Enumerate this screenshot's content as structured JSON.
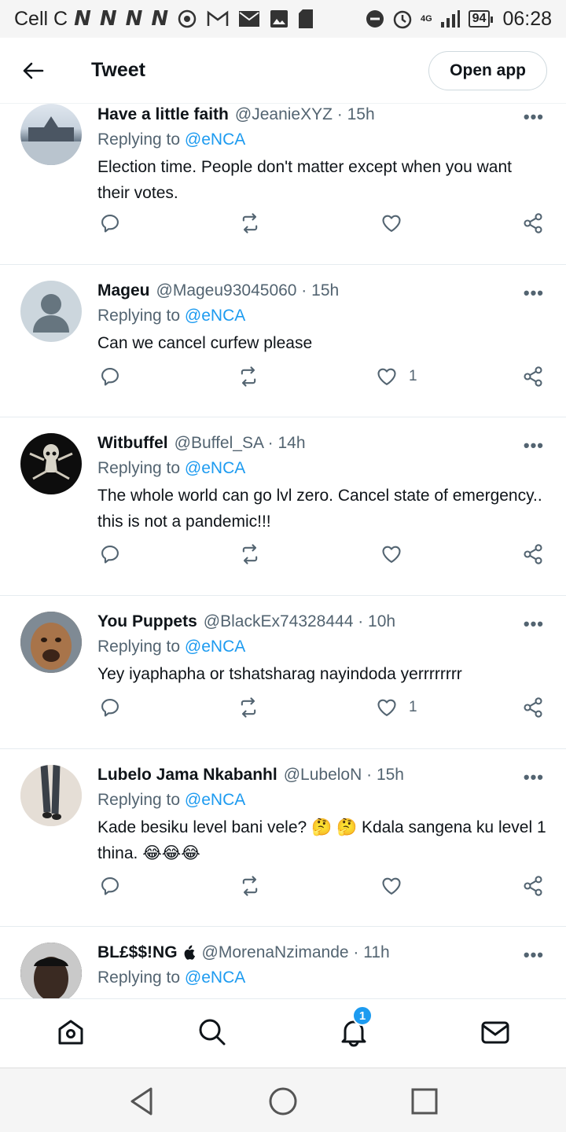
{
  "status_bar": {
    "carrier": "Cell C",
    "network_badges": [
      "N",
      "N",
      "N",
      "N"
    ],
    "network_type": "4G",
    "battery": "94",
    "time": "06:28"
  },
  "header": {
    "back_icon": "arrow-left-icon",
    "title": "Tweet",
    "open_app_label": "Open app"
  },
  "tweets": [
    {
      "name": "Have a little faith",
      "handle": "@JeanieXYZ · 15h",
      "replying_prefix": "Replying to",
      "replying_to": "@eNCA",
      "text": "Election time. People don't matter except when you want their votes.",
      "likes": ""
    },
    {
      "name": "Mageu",
      "handle": "@Mageu93045060 · 15h",
      "replying_prefix": "Replying to",
      "replying_to": "@eNCA",
      "text": "Can we cancel curfew please",
      "likes": "1"
    },
    {
      "name": "Witbuffel",
      "handle": "@Buffel_SA · 14h",
      "replying_prefix": "Replying to",
      "replying_to": "@eNCA",
      "text": "The whole world can go lvl zero. Cancel state of emergency.. this is not a pandemic!!!",
      "likes": ""
    },
    {
      "name": "You Puppets",
      "handle": "@BlackEx74328444 · 10h",
      "replying_prefix": "Replying to",
      "replying_to": "@eNCA",
      "text": "Yey iyaphapha or tshatsharag nayindoda yerrrrrrrr",
      "likes": "1"
    },
    {
      "name": "Lubelo Jama Nkabanhl",
      "handle": "@LubeloN · 15h",
      "replying_prefix": "Replying to",
      "replying_to": "@eNCA",
      "text": "Kade besiku level bani vele? 🤔 🤔 Kdala sangena ku level 1 thina. 😂😂😂",
      "likes": ""
    },
    {
      "name": "BL£$$!NG",
      "handle": "@MorenaNzimande · 11h",
      "replying_prefix": "Replying to",
      "replying_to": "@eNCA",
      "text": "",
      "likes": ""
    }
  ],
  "more_label": "•••",
  "bottom_nav": {
    "items": [
      "home-icon",
      "search-icon",
      "bell-icon",
      "mail-icon"
    ],
    "notification_count": "1"
  },
  "system_nav": [
    "back-triangle-icon",
    "home-circle-icon",
    "recents-square-icon"
  ],
  "colors": {
    "accent": "#1d9bf0",
    "text": "#0f1419",
    "secondary": "#536471"
  }
}
